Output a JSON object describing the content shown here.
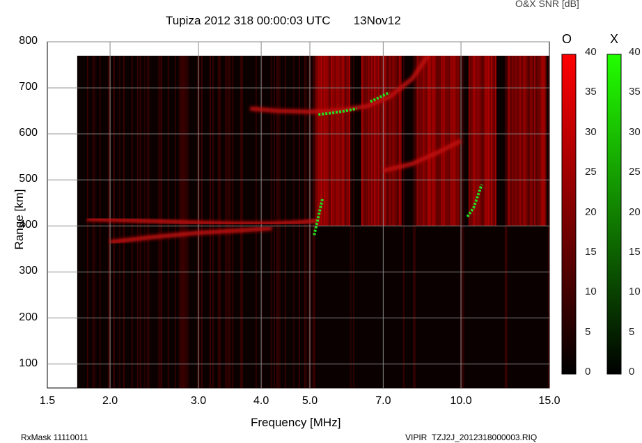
{
  "chart_data": {
    "type": "heatmap",
    "title": "Tupiza 2012 318 00:00:03 UTC",
    "date": "13Nov12",
    "xlabel": "Frequency [MHz]",
    "ylabel": "Range [km]",
    "xscale": "log",
    "xlim": [
      1.5,
      15.0
    ],
    "ylim": [
      48,
      800
    ],
    "xticks": [
      "1.5",
      "2.0",
      "3.0",
      "4.0",
      "5.0",
      "7.0",
      "10.0",
      "15.0"
    ],
    "xtick_values": [
      1.5,
      2.0,
      3.0,
      4.0,
      5.0,
      7.0,
      10.0,
      15.0
    ],
    "yticks": [
      "100",
      "200",
      "300",
      "400",
      "500",
      "600",
      "700",
      "800"
    ],
    "ytick_values": [
      100,
      200,
      300,
      400,
      500,
      600,
      700,
      800
    ],
    "grid": true,
    "data_extent": {
      "freq": [
        1.72,
        15.0
      ],
      "range": [
        48,
        770
      ]
    },
    "colorbar_title": "O&X SNR [dB]",
    "colorbars": [
      {
        "name": "O",
        "color": "#ff0000",
        "ticks": [
          "40",
          "35",
          "30",
          "25",
          "20",
          "15",
          "10",
          "5",
          "0"
        ]
      },
      {
        "name": "X",
        "color": "#22ff00",
        "ticks": [
          "40",
          "35",
          "30",
          "25",
          "20",
          "15",
          "10",
          "5",
          "0"
        ]
      }
    ],
    "strong_bands_MHz": [
      [
        5.1,
        6.0
      ],
      [
        6.3,
        7.6
      ],
      [
        8.1,
        9.9
      ],
      [
        10.3,
        11.7
      ],
      [
        12.3,
        14.8
      ]
    ],
    "o_traces": [
      {
        "freq": [
          1.8,
          2.2,
          2.8,
          3.5,
          4.2,
          4.8,
          5.2
        ],
        "range": [
          415,
          412,
          408,
          405,
          405,
          408,
          412
        ]
      },
      {
        "freq": [
          2.0,
          2.4,
          3.0,
          3.6,
          4.2
        ],
        "range": [
          365,
          375,
          385,
          390,
          395
        ]
      },
      {
        "freq": [
          3.8,
          4.3,
          5.0,
          5.8,
          6.5,
          7.2,
          8.0,
          8.6
        ],
        "range": [
          655,
          650,
          648,
          652,
          660,
          680,
          720,
          770
        ]
      },
      {
        "freq": [
          7.0,
          8.0,
          9.0,
          10.0
        ],
        "range": [
          520,
          535,
          560,
          585
        ]
      }
    ],
    "x_traces": [
      {
        "freq": [
          5.2,
          5.5,
          5.9,
          6.2
        ],
        "range": [
          642,
          645,
          650,
          655
        ]
      },
      {
        "freq": [
          6.6,
          6.9,
          7.2
        ],
        "range": [
          670,
          680,
          690
        ]
      },
      {
        "freq": [
          5.1,
          5.2,
          5.3
        ],
        "range": [
          380,
          420,
          460
        ]
      },
      {
        "freq": [
          10.3,
          10.6,
          11.0
        ],
        "range": [
          420,
          440,
          490
        ]
      }
    ]
  },
  "footer": {
    "left": "RxMask 11110011",
    "right": "VIPIR  TZJ2J_2012318000003.RIQ"
  }
}
